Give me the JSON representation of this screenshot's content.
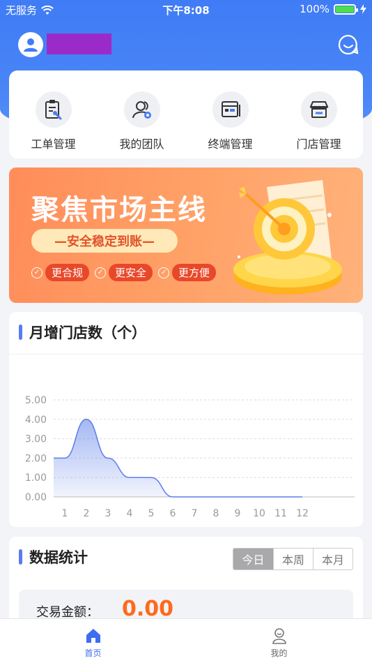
{
  "status_bar": {
    "carrier": "无服务",
    "time": "下午8:08",
    "battery": "100%"
  },
  "quick_actions": [
    {
      "label": "工单管理",
      "icon": "clipboard-wrench-icon"
    },
    {
      "label": "我的团队",
      "icon": "team-icon"
    },
    {
      "label": "终端管理",
      "icon": "terminal-icon"
    },
    {
      "label": "门店管理",
      "icon": "store-icon"
    }
  ],
  "banner": {
    "title": "聚焦市场主线",
    "subtitle": "—安全稳定到账—",
    "tags": [
      "更合规",
      "更安全",
      "更方便"
    ]
  },
  "chart_section": {
    "title": "月增门店数（个）"
  },
  "chart_data": {
    "type": "area",
    "x": [
      1,
      2,
      3,
      4,
      5,
      6,
      7,
      8,
      9,
      10,
      11,
      12
    ],
    "series": [
      {
        "values": [
          2,
          4,
          2,
          1,
          1,
          0,
          0,
          0,
          0,
          0,
          0,
          0
        ]
      }
    ],
    "yticks": [
      "0.00",
      "1.00",
      "2.00",
      "3.00",
      "4.00",
      "5.00"
    ],
    "ylim": [
      0,
      5
    ],
    "grid": true,
    "color": "#5b7de8"
  },
  "stats_section": {
    "title": "数据统计",
    "periods": [
      "今日",
      "本周",
      "本月"
    ],
    "active_period": "今日",
    "amount_label": "交易金额：",
    "amount_value": "0.00"
  },
  "tabbar": {
    "home": "首页",
    "mine": "我的"
  },
  "colors": {
    "primary": "#3f7cf6",
    "accent": "#ff6a1a",
    "username_mask": "#9b2bc9"
  }
}
